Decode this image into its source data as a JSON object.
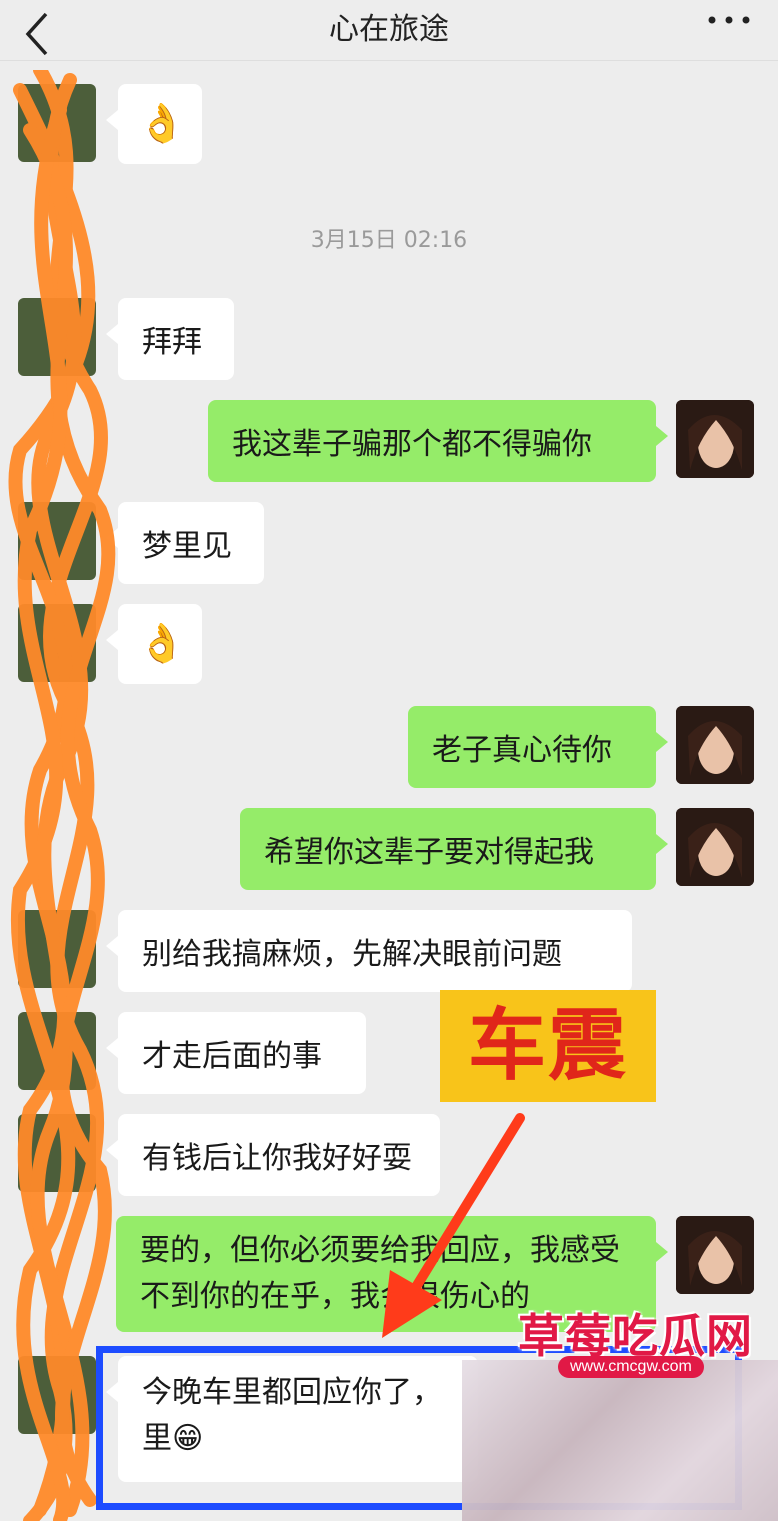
{
  "header": {
    "title": "心在旅途"
  },
  "timestamp": "3月15日 02:16",
  "messages": [
    {
      "text": "👌"
    },
    {
      "text": "拜拜"
    },
    {
      "text": "我这辈子骗那个都不得骗你"
    },
    {
      "text": "梦里见"
    },
    {
      "text": "👌"
    },
    {
      "text": "老子真心待你"
    },
    {
      "text": "希望你这辈子要对得起我"
    },
    {
      "text": "别给我搞麻烦，先解决眼前问题"
    },
    {
      "text": "才走后面的事"
    },
    {
      "text": "有钱后让你我好好耍"
    },
    {
      "text": "要的，但你必须要给我回应，我感受不到你的在乎，我会很伤心的"
    },
    {
      "text": "今晚车里都回应你了，里😁"
    }
  ],
  "annotation": {
    "label": "车震",
    "label_bg": "#f8c41a",
    "label_color": "#e0261a",
    "arrow_color": "#ff3b1a",
    "box_color": "#1d4cff",
    "scribble_color": "#ff8a2a"
  },
  "watermark": {
    "title": "草莓吃瓜网",
    "url": "www.cmcgw.com"
  }
}
